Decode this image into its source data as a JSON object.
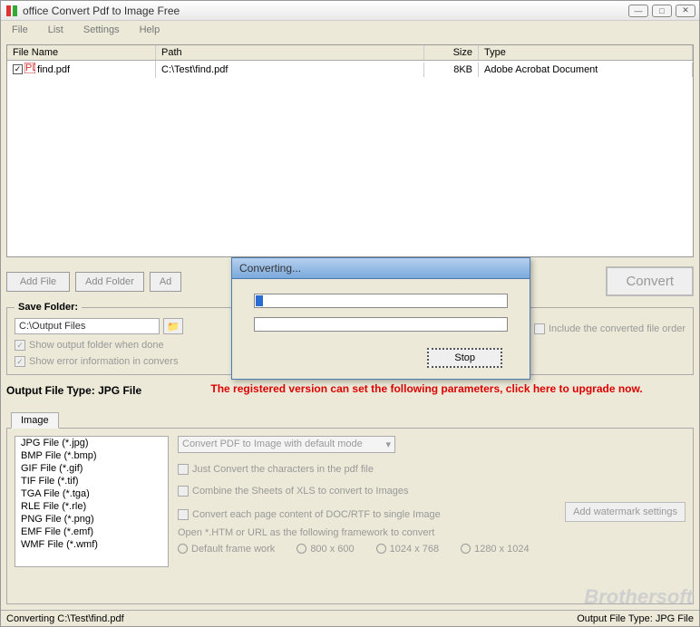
{
  "window": {
    "title": "office Convert Pdf to Image Free"
  },
  "menu": {
    "file": "File",
    "list": "List",
    "settings": "Settings",
    "help": "Help"
  },
  "grid": {
    "headers": {
      "name": "File Name",
      "path": "Path",
      "size": "Size",
      "type": "Type"
    },
    "rows": [
      {
        "name": "find.pdf",
        "path": "C:\\Test\\find.pdf",
        "size": "8KB",
        "type": "Adobe Acrobat Document"
      }
    ]
  },
  "buttons": {
    "add_file": "Add File",
    "add_folder": "Add Folder",
    "add_url": "Ad",
    "convert": "Convert"
  },
  "save_folder": {
    "legend": "Save Folder:",
    "path": "C:\\Output Files",
    "show_output": "Show output folder when done",
    "show_error": "Show error information in convers",
    "include_order": "Include the converted file order"
  },
  "red_notice": "The registered version can set the following parameters, click here to upgrade now.",
  "output_type": {
    "label": "Output File Type:  JPG File",
    "tab": "Image"
  },
  "formats": [
    "JPG File  (*.jpg)",
    "BMP File  (*.bmp)",
    "GIF File  (*.gif)",
    "TIF File  (*.tif)",
    "TGA File  (*.tga)",
    "RLE File  (*.rle)",
    "PNG File  (*.png)",
    "EMF File  (*.emf)",
    "WMF File  (*.wmf)"
  ],
  "options": {
    "mode": "Convert PDF to Image with default mode",
    "just_chars": "Just Convert the characters in the pdf file",
    "combine_xls": "Combine the Sheets of XLS to convert to Images",
    "each_page": "Convert each page content of DOC/RTF to single Image",
    "open_htm": "Open *.HTM or URL as the following framework to convert",
    "watermark_btn": "Add watermark settings",
    "frames": {
      "default": "Default frame work",
      "r800": "800 x 600",
      "r1024": "1024 x 768",
      "r1280": "1280 x 1024"
    }
  },
  "status": {
    "left": "Converting  C:\\Test\\find.pdf",
    "right": "Output File Type:  JPG File"
  },
  "dialog": {
    "title": "Converting...",
    "stop": "Stop"
  },
  "watermark_text": "Brothersoft"
}
